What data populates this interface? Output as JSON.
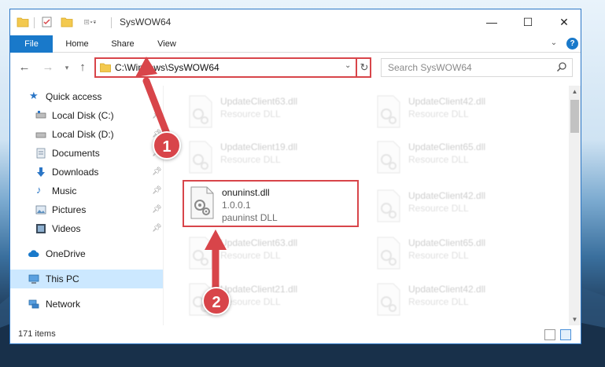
{
  "window": {
    "title": "SysWOW64",
    "controls": {
      "minimize": "—",
      "maximize": "☐",
      "close": "✕"
    }
  },
  "ribbon": {
    "tabs": [
      {
        "label": "File"
      },
      {
        "label": "Home"
      },
      {
        "label": "Share"
      },
      {
        "label": "View"
      }
    ],
    "help": "?"
  },
  "address_bar": {
    "path": "C:\\Windows\\SysWOW64"
  },
  "search": {
    "placeholder": "Search SysWOW64"
  },
  "sidebar": {
    "items": [
      {
        "label": "Quick access",
        "icon": "star-icon",
        "pinned": false
      },
      {
        "label": "Local Disk (C:)",
        "icon": "drive-icon",
        "pinned": true
      },
      {
        "label": "Local Disk (D:)",
        "icon": "drive-icon",
        "pinned": true
      },
      {
        "label": "Documents",
        "icon": "documents-icon",
        "pinned": true
      },
      {
        "label": "Downloads",
        "icon": "download-icon",
        "pinned": true
      },
      {
        "label": "Music",
        "icon": "music-icon",
        "pinned": true
      },
      {
        "label": "Pictures",
        "icon": "pictures-icon",
        "pinned": true
      },
      {
        "label": "Videos",
        "icon": "videos-icon",
        "pinned": true
      },
      {
        "label": "OneDrive",
        "icon": "cloud-icon",
        "pinned": false
      },
      {
        "label": "This PC",
        "icon": "computer-icon",
        "pinned": false,
        "selected": true
      },
      {
        "label": "Network",
        "icon": "network-icon",
        "pinned": false
      }
    ]
  },
  "files": {
    "left_column": [
      {
        "name": "UpdateClient63.dll",
        "line1": "Resource DLL",
        "line2": ""
      },
      {
        "name": "UpdateClient19.dll",
        "line1": "Resource DLL",
        "line2": ""
      },
      {
        "name": "onuninst.dll",
        "line1": "1.0.0.1",
        "line2": "pauninst DLL",
        "highlighted": true
      },
      {
        "name": "UpdateClient63.dll",
        "line1": "Resource DLL",
        "line2": ""
      },
      {
        "name": "UpdateClient21.dll",
        "line1": "Resource DLL",
        "line2": ""
      }
    ],
    "right_column": [
      {
        "name": "UpdateClient42.dll",
        "line1": "Resource DLL"
      },
      {
        "name": "UpdateClient65.dll",
        "line1": "Resource DLL"
      },
      {
        "name": "UpdateClient42.dll",
        "line1": "Resource DLL"
      },
      {
        "name": "UpdateClient65.dll",
        "line1": "Resource DLL"
      },
      {
        "name": "UpdateClient42.dll",
        "line1": "Resource DLL"
      }
    ]
  },
  "status": {
    "item_count": "171 items"
  },
  "annotations": [
    {
      "label": "1"
    },
    {
      "label": "2"
    }
  ],
  "colors": {
    "accent": "#1979ca",
    "highlight_red": "#d8454a",
    "selected_bg": "#cce8ff"
  }
}
